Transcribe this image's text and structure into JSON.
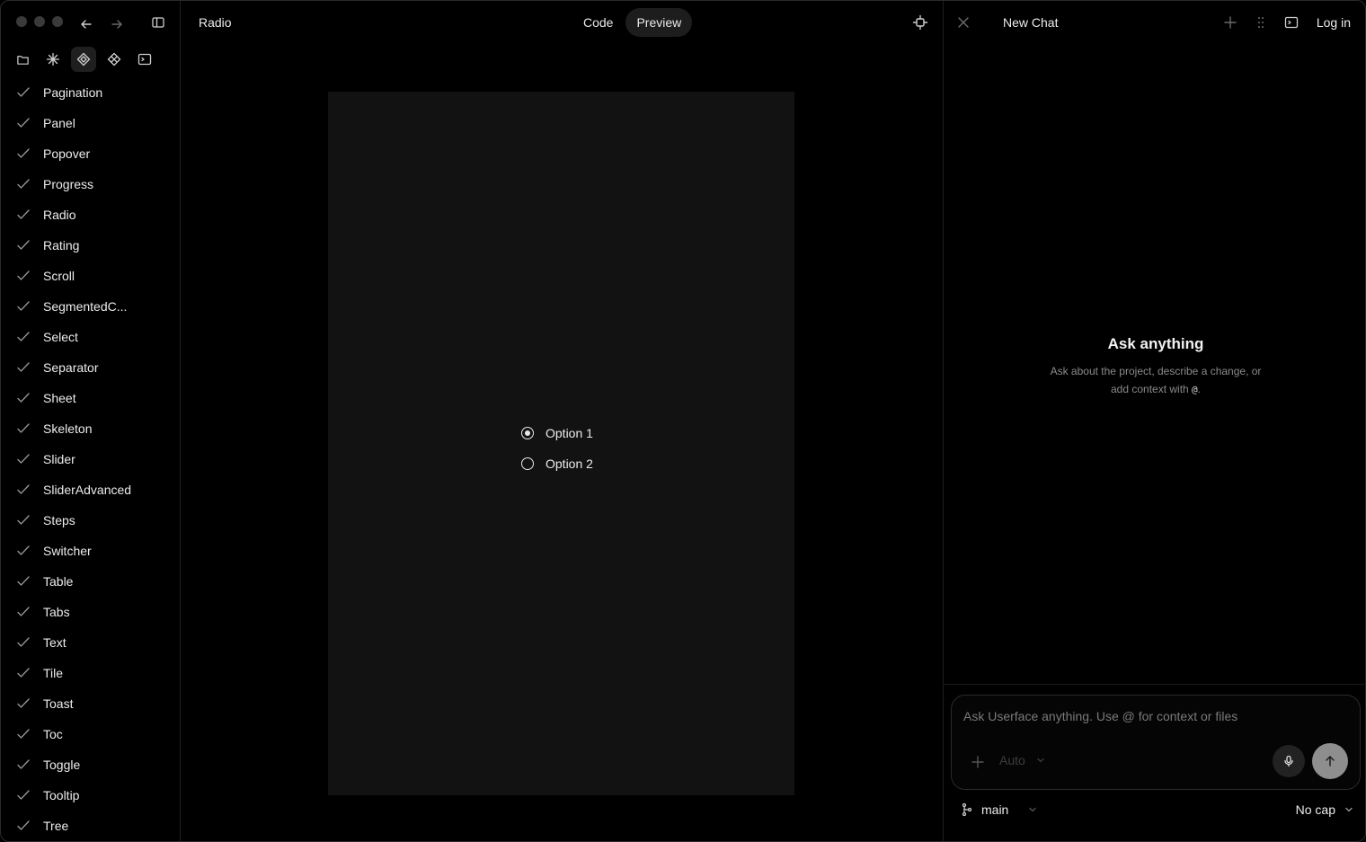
{
  "sidebar": {
    "components": [
      {
        "label": "Pagination"
      },
      {
        "label": "Panel"
      },
      {
        "label": "Popover"
      },
      {
        "label": "Progress"
      },
      {
        "label": "Radio"
      },
      {
        "label": "Rating"
      },
      {
        "label": "Scroll"
      },
      {
        "label": "SegmentedC..."
      },
      {
        "label": "Select"
      },
      {
        "label": "Separator"
      },
      {
        "label": "Sheet"
      },
      {
        "label": "Skeleton"
      },
      {
        "label": "Slider"
      },
      {
        "label": "SliderAdvanced"
      },
      {
        "label": "Steps"
      },
      {
        "label": "Switcher"
      },
      {
        "label": "Table"
      },
      {
        "label": "Tabs"
      },
      {
        "label": "Text"
      },
      {
        "label": "Tile"
      },
      {
        "label": "Toast"
      },
      {
        "label": "Toc"
      },
      {
        "label": "Toggle"
      },
      {
        "label": "Tooltip"
      },
      {
        "label": "Tree"
      }
    ]
  },
  "main": {
    "title": "Radio",
    "tabs": {
      "code": "Code",
      "preview": "Preview"
    },
    "active_tab": "Preview",
    "preview": {
      "options": [
        {
          "label": "Option 1",
          "selected": true
        },
        {
          "label": "Option 2",
          "selected": false
        }
      ]
    }
  },
  "chat": {
    "title": "New Chat",
    "login": "Log in",
    "empty_title": "Ask anything",
    "empty_desc_1": "Ask about the project, describe a change, or",
    "empty_desc_2": "add context with",
    "empty_desc_at": "@",
    "empty_desc_end": ".",
    "input_placeholder": "Ask Userface anything. Use @ for context or files",
    "model": "Auto",
    "branch": "main",
    "cap": "No cap"
  }
}
